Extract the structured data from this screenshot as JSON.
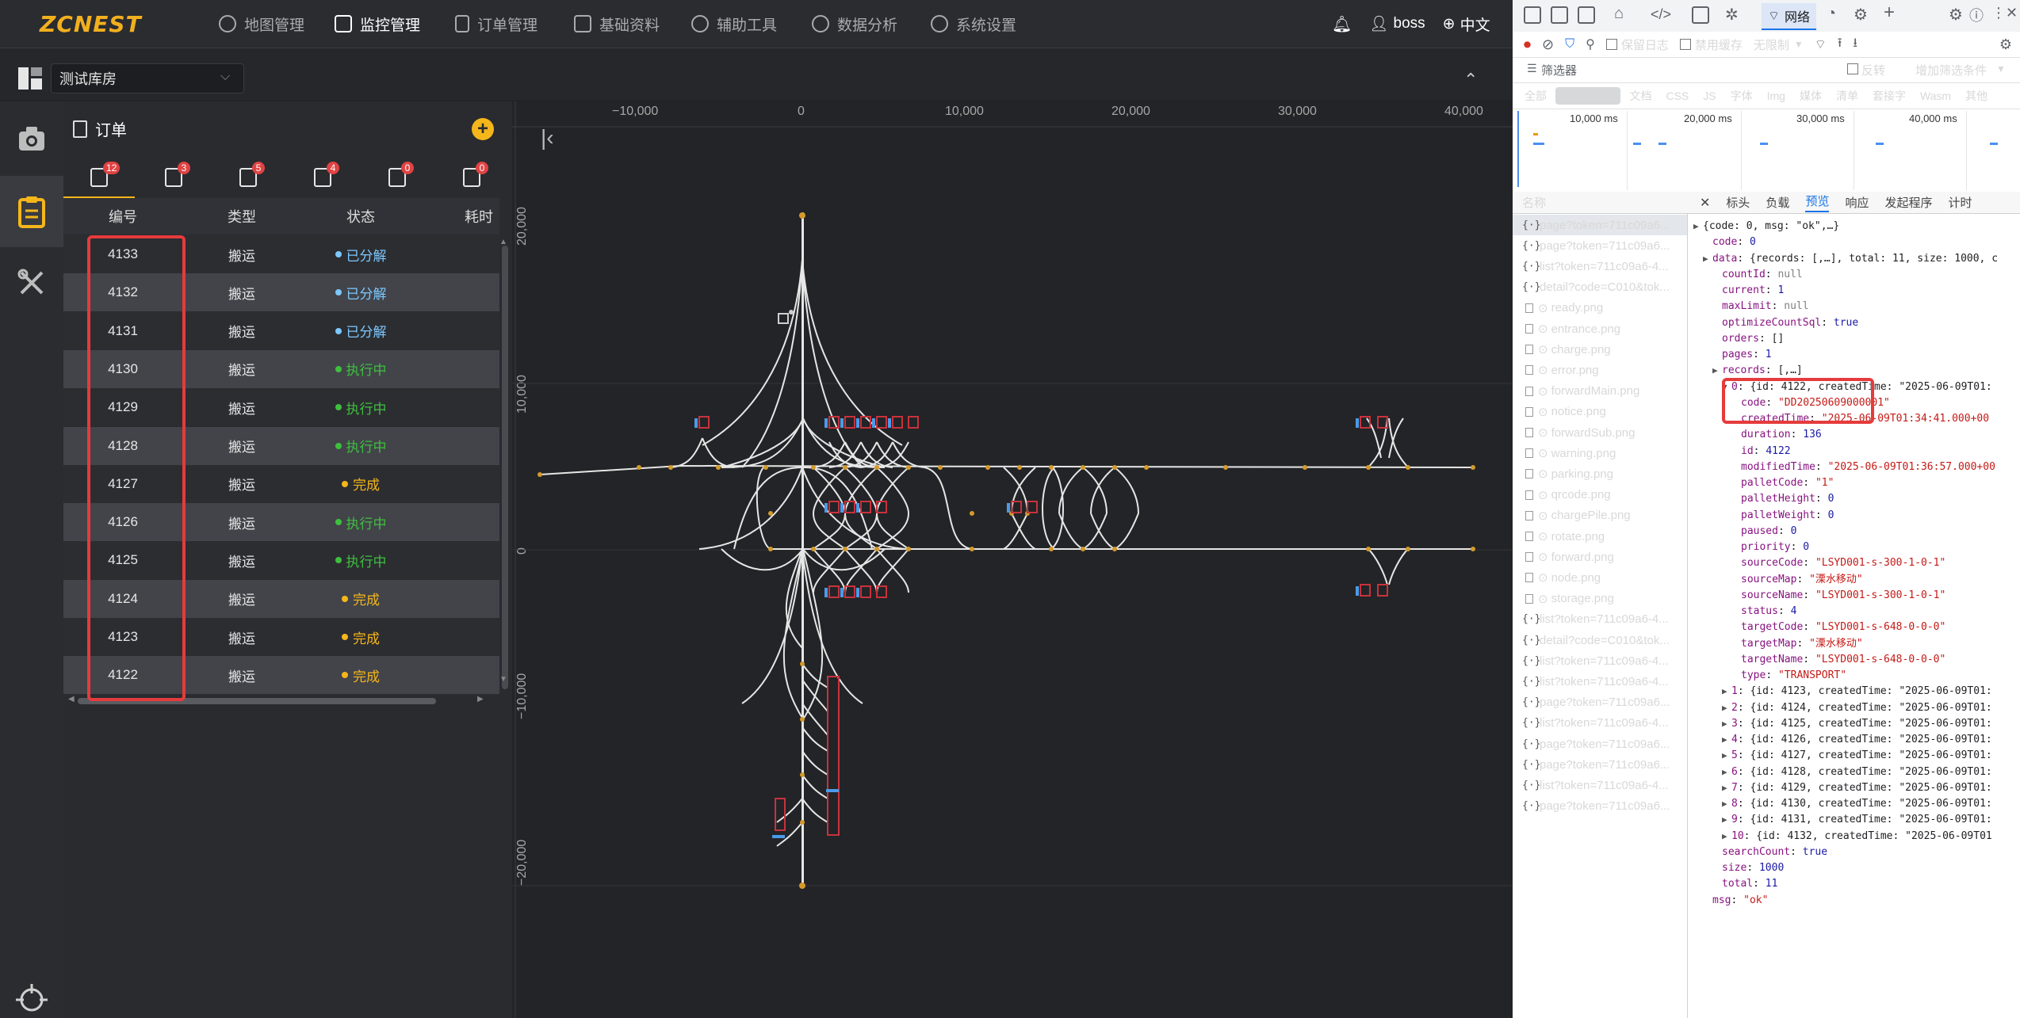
{
  "nav": {
    "logo": "ZCNEST",
    "items": [
      {
        "label": "地图管理",
        "icon": "location-icon"
      },
      {
        "label": "监控管理",
        "icon": "monitor-icon",
        "active": true
      },
      {
        "label": "订单管理",
        "icon": "document-icon"
      },
      {
        "label": "基础资料",
        "icon": "sliders-icon"
      },
      {
        "label": "辅助工具",
        "icon": "gear-icon"
      },
      {
        "label": "数据分析",
        "icon": "gear-icon"
      },
      {
        "label": "系统设置",
        "icon": "gear-icon"
      }
    ],
    "user": "boss",
    "language": "中文"
  },
  "warehouse": {
    "selected": "测试库房"
  },
  "panel": {
    "title": "订单",
    "tabs": [
      {
        "badge": "12"
      },
      {
        "badge": "3"
      },
      {
        "badge": "5"
      },
      {
        "badge": "4"
      },
      {
        "badge": "0"
      },
      {
        "badge": "0"
      }
    ],
    "columns": [
      "编号",
      "类型",
      "状态",
      "耗时"
    ],
    "rows": [
      {
        "id": "4133",
        "type": "搬运",
        "status": "已分解"
      },
      {
        "id": "4132",
        "type": "搬运",
        "status": "已分解"
      },
      {
        "id": "4131",
        "type": "搬运",
        "status": "已分解"
      },
      {
        "id": "4130",
        "type": "搬运",
        "status": "执行中"
      },
      {
        "id": "4129",
        "type": "搬运",
        "status": "执行中"
      },
      {
        "id": "4128",
        "type": "搬运",
        "status": "执行中"
      },
      {
        "id": "4127",
        "type": "搬运",
        "status": "完成"
      },
      {
        "id": "4126",
        "type": "搬运",
        "status": "执行中"
      },
      {
        "id": "4125",
        "type": "搬运",
        "status": "执行中"
      },
      {
        "id": "4124",
        "type": "搬运",
        "status": "完成"
      },
      {
        "id": "4123",
        "type": "搬运",
        "status": "完成"
      },
      {
        "id": "4122",
        "type": "搬运",
        "status": "完成"
      }
    ],
    "status_colors": {
      "已分解": "#7cc8ff",
      "执行中": "#3fbf3f",
      "完成": "#f5b61b"
    }
  },
  "map": {
    "x_ticks": [
      "−10,000",
      "0",
      "10,000",
      "20,000",
      "30,000",
      "40,000"
    ],
    "y_ticks": [
      "20,000",
      "10,000",
      "0",
      "−10,000",
      "−20,000"
    ]
  },
  "devtools": {
    "network_tab": "网络",
    "toolbar2": [
      "保留日志",
      "禁用缓存",
      "无限制"
    ],
    "filter_placeholder": "筛选器",
    "invert": "反转",
    "more_filters": "增加筛选条件",
    "types": [
      "全部",
      "Fetch/XHR",
      "文档",
      "CSS",
      "JS",
      "字体",
      "Img",
      "媒体",
      "清单",
      "套接字",
      "Wasm",
      "其他"
    ],
    "timeline": [
      "10,000 ms",
      "20,000 ms",
      "30,000 ms",
      "40,000 ms"
    ],
    "names_header": "名称",
    "preview_tabs": [
      "标头",
      "负载",
      "预览",
      "响应",
      "发起程序",
      "计时"
    ],
    "requests": [
      {
        "name": "page?token=711c09a6...",
        "kind": "xhr"
      },
      {
        "name": "page?token=711c09a6...",
        "kind": "xhr"
      },
      {
        "name": "list?token=711c09a6-4...",
        "kind": "xhr"
      },
      {
        "name": "detail?code=C010&tok...",
        "kind": "xhr"
      },
      {
        "name": "ready.png",
        "kind": "img"
      },
      {
        "name": "entrance.png",
        "kind": "img"
      },
      {
        "name": "charge.png",
        "kind": "img"
      },
      {
        "name": "error.png",
        "kind": "img"
      },
      {
        "name": "forwardMain.png",
        "kind": "img"
      },
      {
        "name": "notice.png",
        "kind": "img"
      },
      {
        "name": "forwardSub.png",
        "kind": "img"
      },
      {
        "name": "warning.png",
        "kind": "img"
      },
      {
        "name": "parking.png",
        "kind": "img"
      },
      {
        "name": "qrcode.png",
        "kind": "img"
      },
      {
        "name": "chargePile.png",
        "kind": "img"
      },
      {
        "name": "rotate.png",
        "kind": "img"
      },
      {
        "name": "forward.png",
        "kind": "img"
      },
      {
        "name": "node.png",
        "kind": "img"
      },
      {
        "name": "storage.png",
        "kind": "img"
      },
      {
        "name": "list?token=711c09a6-4...",
        "kind": "xhr"
      },
      {
        "name": "detail?code=C010&tok...",
        "kind": "xhr"
      },
      {
        "name": "list?token=711c09a6-4...",
        "kind": "xhr"
      },
      {
        "name": "list?token=711c09a6-4...",
        "kind": "xhr"
      },
      {
        "name": "page?token=711c09a6...",
        "kind": "xhr"
      },
      {
        "name": "list?token=711c09a6-4...",
        "kind": "xhr"
      },
      {
        "name": "page?token=711c09a6...",
        "kind": "xhr"
      },
      {
        "name": "page?token=711c09a6...",
        "kind": "xhr"
      },
      {
        "name": "list?token=711c09a6-4...",
        "kind": "xhr"
      },
      {
        "name": "page?token=711c09a6...",
        "kind": "xhr"
      }
    ],
    "json_lines": [
      {
        "indent": 0,
        "tri": "▶",
        "html": "{code: 0, msg: \"ok\",…}"
      },
      {
        "indent": 1,
        "tri": "",
        "html": "<span class='k'>code</span>: <span class='n'>0</span>"
      },
      {
        "indent": 1,
        "tri": "▶",
        "html": "<span class='k'>data</span>: {records: [,…], total: 11, size: 1000, c"
      },
      {
        "indent": 2,
        "tri": "",
        "html": "<span class='k'>countId</span>: <span class='nl'>null</span>"
      },
      {
        "indent": 2,
        "tri": "",
        "html": "<span class='k'>current</span>: <span class='n'>1</span>"
      },
      {
        "indent": 2,
        "tri": "",
        "html": "<span class='k'>maxLimit</span>: <span class='nl'>null</span>"
      },
      {
        "indent": 2,
        "tri": "",
        "html": "<span class='k'>optimizeCountSql</span>: <span class='n'>true</span>"
      },
      {
        "indent": 2,
        "tri": "",
        "html": "<span class='k'>orders</span>: []"
      },
      {
        "indent": 2,
        "tri": "",
        "html": "<span class='k'>pages</span>: <span class='n'>1</span>"
      },
      {
        "indent": 2,
        "tri": "▶",
        "html": "<span class='k'>records</span>: [,…]"
      },
      {
        "indent": 3,
        "tri": "▼",
        "html": "<span class='k'>0</span>: {id: 4122, createdTime: \"2025-06-09T01:"
      },
      {
        "indent": 4,
        "tri": "",
        "html": "<span class='k'>code</span>: <span class='s'>\"DD20250609000001\"</span>"
      },
      {
        "indent": 4,
        "tri": "",
        "html": "<span class='k'>createdTime</span>: <span class='s'>\"2025-06-09T01:34:41.000+00</span>"
      },
      {
        "indent": 4,
        "tri": "",
        "html": "<span class='k'>duration</span>: <span class='n'>136</span>"
      },
      {
        "indent": 4,
        "tri": "",
        "html": "<span class='k'>id</span>: <span class='n'>4122</span>"
      },
      {
        "indent": 4,
        "tri": "",
        "html": "<span class='k'>modifiedTime</span>: <span class='s'>\"2025-06-09T01:36:57.000+00</span>"
      },
      {
        "indent": 4,
        "tri": "",
        "html": "<span class='k'>palletCode</span>: <span class='s'>\"1\"</span>"
      },
      {
        "indent": 4,
        "tri": "",
        "html": "<span class='k'>palletHeight</span>: <span class='n'>0</span>"
      },
      {
        "indent": 4,
        "tri": "",
        "html": "<span class='k'>palletWeight</span>: <span class='n'>0</span>"
      },
      {
        "indent": 4,
        "tri": "",
        "html": "<span class='k'>paused</span>: <span class='n'>0</span>"
      },
      {
        "indent": 4,
        "tri": "",
        "html": "<span class='k'>priority</span>: <span class='n'>0</span>"
      },
      {
        "indent": 4,
        "tri": "",
        "html": "<span class='k'>sourceCode</span>: <span class='s'>\"LSYD001-s-300-1-0-1\"</span>"
      },
      {
        "indent": 4,
        "tri": "",
        "html": "<span class='k'>sourceMap</span>: <span class='s'>\"溧水移动\"</span>"
      },
      {
        "indent": 4,
        "tri": "",
        "html": "<span class='k'>sourceName</span>: <span class='s'>\"LSYD001-s-300-1-0-1\"</span>"
      },
      {
        "indent": 4,
        "tri": "",
        "html": "<span class='k'>status</span>: <span class='n'>4</span>"
      },
      {
        "indent": 4,
        "tri": "",
        "html": "<span class='k'>targetCode</span>: <span class='s'>\"LSYD001-s-648-0-0-0\"</span>"
      },
      {
        "indent": 4,
        "tri": "",
        "html": "<span class='k'>targetMap</span>: <span class='s'>\"溧水移动\"</span>"
      },
      {
        "indent": 4,
        "tri": "",
        "html": "<span class='k'>targetName</span>: <span class='s'>\"LSYD001-s-648-0-0-0\"</span>"
      },
      {
        "indent": 4,
        "tri": "",
        "html": "<span class='k'>type</span>: <span class='s'>\"TRANSPORT\"</span>"
      },
      {
        "indent": 3,
        "tri": "▶",
        "html": "<span class='k'>1</span>: {id: 4123, createdTime: \"2025-06-09T01:"
      },
      {
        "indent": 3,
        "tri": "▶",
        "html": "<span class='k'>2</span>: {id: 4124, createdTime: \"2025-06-09T01:"
      },
      {
        "indent": 3,
        "tri": "▶",
        "html": "<span class='k'>3</span>: {id: 4125, createdTime: \"2025-06-09T01:"
      },
      {
        "indent": 3,
        "tri": "▶",
        "html": "<span class='k'>4</span>: {id: 4126, createdTime: \"2025-06-09T01:"
      },
      {
        "indent": 3,
        "tri": "▶",
        "html": "<span class='k'>5</span>: {id: 4127, createdTime: \"2025-06-09T01:"
      },
      {
        "indent": 3,
        "tri": "▶",
        "html": "<span class='k'>6</span>: {id: 4128, createdTime: \"2025-06-09T01:"
      },
      {
        "indent": 3,
        "tri": "▶",
        "html": "<span class='k'>7</span>: {id: 4129, createdTime: \"2025-06-09T01:"
      },
      {
        "indent": 3,
        "tri": "▶",
        "html": "<span class='k'>8</span>: {id: 4130, createdTime: \"2025-06-09T01:"
      },
      {
        "indent": 3,
        "tri": "▶",
        "html": "<span class='k'>9</span>: {id: 4131, createdTime: \"2025-06-09T01:"
      },
      {
        "indent": 3,
        "tri": "▶",
        "html": "<span class='k'>10</span>: {id: 4132, createdTime: \"2025-06-09T01"
      },
      {
        "indent": 2,
        "tri": "",
        "html": "<span class='k'>searchCount</span>: <span class='n'>true</span>"
      },
      {
        "indent": 2,
        "tri": "",
        "html": "<span class='k'>size</span>: <span class='n'>1000</span>"
      },
      {
        "indent": 2,
        "tri": "",
        "html": "<span class='k'>total</span>: <span class='n'>11</span>"
      },
      {
        "indent": 1,
        "tri": "",
        "html": "<span class='k'>msg</span>: <span class='s'>\"ok\"</span>"
      }
    ]
  }
}
